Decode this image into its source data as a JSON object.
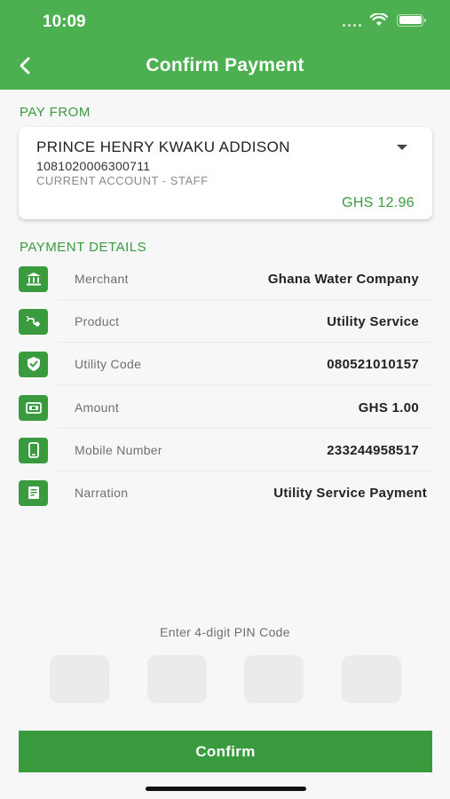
{
  "status_bar": {
    "time": "10:09"
  },
  "header": {
    "title": "Confirm Payment",
    "back_icon": "chevron-left-icon"
  },
  "pay_from": {
    "section_label": "PAY FROM",
    "account_name": "PRINCE HENRY KWAKU ADDISON",
    "account_number": "1081020006300711",
    "account_type": "CURRENT ACCOUNT - STAFF",
    "balance": "GHS 12.96"
  },
  "payment_details": {
    "section_label": "PAYMENT DETAILS",
    "rows": [
      {
        "icon": "bank-icon",
        "label": "Merchant",
        "value": "Ghana Water Company"
      },
      {
        "icon": "plug-icon",
        "label": "Product",
        "value": "Utility Service"
      },
      {
        "icon": "shield-check-icon",
        "label": "Utility Code",
        "value": "080521010157"
      },
      {
        "icon": "cash-icon",
        "label": "Amount",
        "value": "GHS 1.00"
      },
      {
        "icon": "mobile-phone-icon",
        "label": "Mobile Number",
        "value": "233244958517"
      },
      {
        "icon": "receipt-icon",
        "label": "Narration",
        "value": "Utility Service Payment"
      }
    ]
  },
  "pin": {
    "label": "Enter 4-digit PIN Code",
    "digits": [
      "",
      "",
      "",
      ""
    ]
  },
  "confirm_button": {
    "label": "Confirm"
  },
  "colors": {
    "primary": "#4caf50",
    "accent": "#3a9b3e"
  }
}
